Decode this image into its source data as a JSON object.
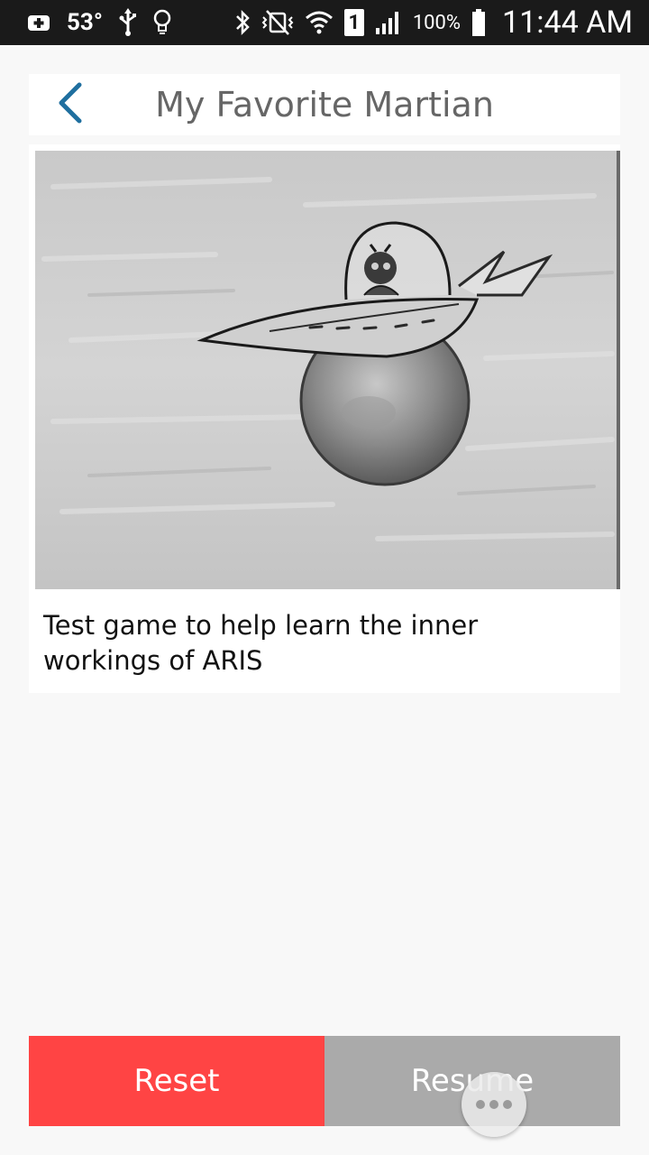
{
  "status_bar": {
    "temperature": "53°",
    "battery_percent": "100%",
    "sim_slot": "1",
    "time": "11:44 AM",
    "icons": [
      "add-box-icon",
      "usb-icon",
      "lightbulb-icon",
      "bluetooth-icon",
      "vibrate-off-icon",
      "wifi-icon",
      "sim-card-icon",
      "signal-icon",
      "battery-icon"
    ]
  },
  "header": {
    "title": "My Favorite Martian",
    "back_icon": "chevron-left-icon"
  },
  "game": {
    "image_alt": "martian-spaceship-sketch",
    "description": "Test game to help learn the inner workings of ARIS"
  },
  "actions": {
    "reset_label": "Reset",
    "resume_label": "Resume",
    "reset_color": "#ff4444",
    "resume_color": "#aaaaaa"
  },
  "floating_button": {
    "icon": "more-horizontal-icon"
  },
  "colors": {
    "accent": "#1f6f9f",
    "title_text": "#666666",
    "background": "#f8f8f8"
  }
}
